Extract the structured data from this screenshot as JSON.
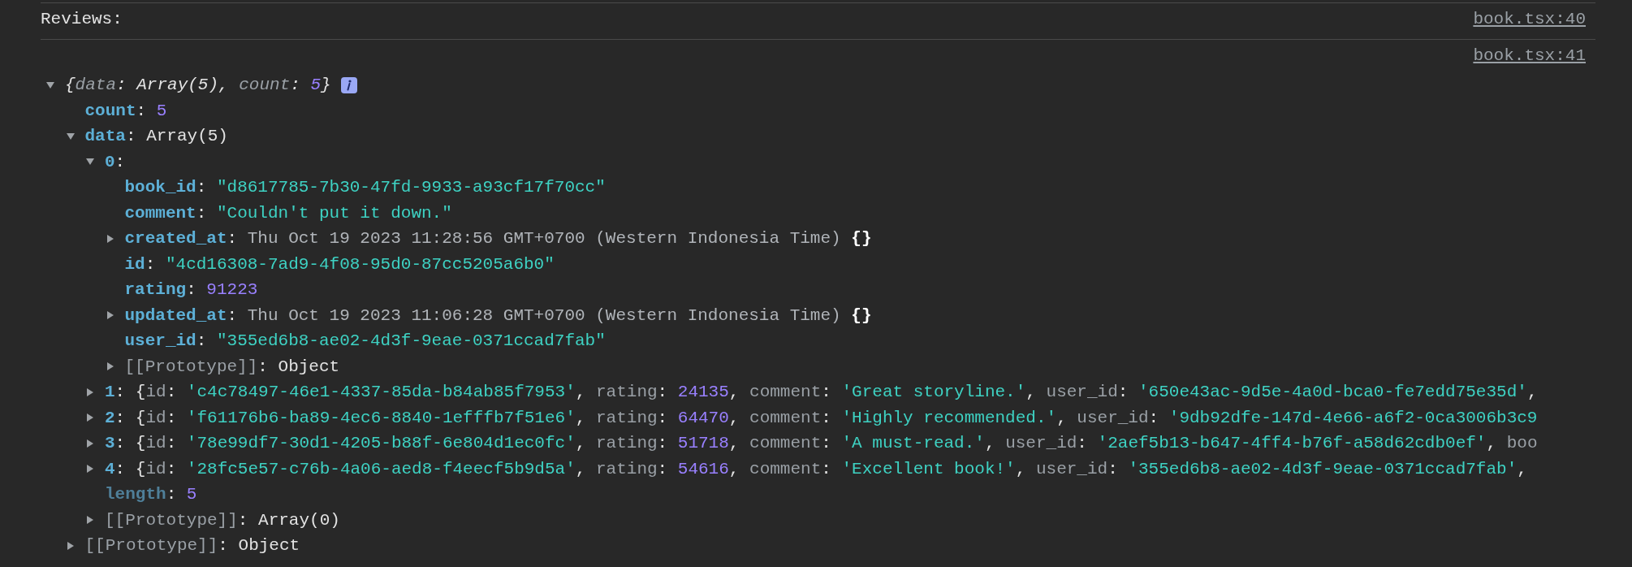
{
  "messages": [
    {
      "text": "Reviews:",
      "source": "book.tsx:40"
    },
    {
      "source": "book.tsx:41",
      "tree": {
        "expanded": true,
        "parts": [
          {
            "kind": "punct",
            "text": "{"
          },
          {
            "kind": "prevkey",
            "text": "data"
          },
          {
            "kind": "punct",
            "text": ": Array(5), "
          },
          {
            "kind": "prevkey",
            "text": "count"
          },
          {
            "kind": "punct",
            "text": ": "
          },
          {
            "kind": "number",
            "text": "5"
          },
          {
            "kind": "punct",
            "text": "}"
          }
        ],
        "info_badge": true,
        "children": [
          {
            "parts": [
              {
                "kind": "key",
                "text": "count"
              },
              {
                "kind": "punct",
                "text": ": "
              },
              {
                "kind": "number",
                "text": "5"
              }
            ]
          },
          {
            "expanded": true,
            "parts": [
              {
                "kind": "key",
                "text": "data"
              },
              {
                "kind": "punct",
                "text": ": Array(5)"
              }
            ],
            "children": [
              {
                "expanded": true,
                "parts": [
                  {
                    "kind": "key",
                    "text": "0"
                  },
                  {
                    "kind": "punct",
                    "text": ":"
                  }
                ],
                "children": [
                  {
                    "parts": [
                      {
                        "kind": "key",
                        "text": "book_id"
                      },
                      {
                        "kind": "punct",
                        "text": ": "
                      },
                      {
                        "kind": "string",
                        "text": "\"d8617785-7b30-47fd-9933-a93cf17f70cc\""
                      }
                    ]
                  },
                  {
                    "parts": [
                      {
                        "kind": "key",
                        "text": "comment"
                      },
                      {
                        "kind": "punct",
                        "text": ": "
                      },
                      {
                        "kind": "string",
                        "text": "\"Couldn't put it down.\""
                      }
                    ]
                  },
                  {
                    "expanded": false,
                    "parts": [
                      {
                        "kind": "key",
                        "text": "created_at"
                      },
                      {
                        "kind": "punct",
                        "text": ": "
                      },
                      {
                        "kind": "date",
                        "text": "Thu Oct 19 2023 11:28:56 GMT+0700 (Western Indonesia Time) "
                      },
                      {
                        "kind": "brace",
                        "text": "{}"
                      }
                    ]
                  },
                  {
                    "parts": [
                      {
                        "kind": "key",
                        "text": "id"
                      },
                      {
                        "kind": "punct",
                        "text": ": "
                      },
                      {
                        "kind": "string",
                        "text": "\"4cd16308-7ad9-4f08-95d0-87cc5205a6b0\""
                      }
                    ]
                  },
                  {
                    "parts": [
                      {
                        "kind": "key",
                        "text": "rating"
                      },
                      {
                        "kind": "punct",
                        "text": ": "
                      },
                      {
                        "kind": "number",
                        "text": "91223"
                      }
                    ]
                  },
                  {
                    "expanded": false,
                    "parts": [
                      {
                        "kind": "key",
                        "text": "updated_at"
                      },
                      {
                        "kind": "punct",
                        "text": ": "
                      },
                      {
                        "kind": "date",
                        "text": "Thu Oct 19 2023 11:06:28 GMT+0700 (Western Indonesia Time) "
                      },
                      {
                        "kind": "brace",
                        "text": "{}"
                      }
                    ]
                  },
                  {
                    "parts": [
                      {
                        "kind": "key",
                        "text": "user_id"
                      },
                      {
                        "kind": "punct",
                        "text": ": "
                      },
                      {
                        "kind": "string",
                        "text": "\"355ed6b8-ae02-4d3f-9eae-0371ccad7fab\""
                      }
                    ]
                  },
                  {
                    "expanded": false,
                    "parts": [
                      {
                        "kind": "proto",
                        "text": "[[Prototype]]"
                      },
                      {
                        "kind": "punct",
                        "text": ": Object"
                      }
                    ]
                  }
                ]
              },
              {
                "expanded": false,
                "parts": [
                  {
                    "kind": "key",
                    "text": "1"
                  },
                  {
                    "kind": "punct",
                    "text": ": {"
                  },
                  {
                    "kind": "prevkey",
                    "text": "id"
                  },
                  {
                    "kind": "punct",
                    "text": ": "
                  },
                  {
                    "kind": "string",
                    "text": "'c4c78497-46e1-4337-85da-b84ab85f7953'"
                  },
                  {
                    "kind": "punct",
                    "text": ", "
                  },
                  {
                    "kind": "prevkey",
                    "text": "rating"
                  },
                  {
                    "kind": "punct",
                    "text": ": "
                  },
                  {
                    "kind": "number",
                    "text": "24135"
                  },
                  {
                    "kind": "punct",
                    "text": ", "
                  },
                  {
                    "kind": "prevkey",
                    "text": "comment"
                  },
                  {
                    "kind": "punct",
                    "text": ": "
                  },
                  {
                    "kind": "string",
                    "text": "'Great storyline.'"
                  },
                  {
                    "kind": "punct",
                    "text": ", "
                  },
                  {
                    "kind": "prevkey",
                    "text": "user_id"
                  },
                  {
                    "kind": "punct",
                    "text": ": "
                  },
                  {
                    "kind": "string",
                    "text": "'650e43ac-9d5e-4a0d-bca0-fe7edd75e35d'"
                  },
                  {
                    "kind": "punct",
                    "text": ","
                  }
                ]
              },
              {
                "expanded": false,
                "parts": [
                  {
                    "kind": "key",
                    "text": "2"
                  },
                  {
                    "kind": "punct",
                    "text": ": {"
                  },
                  {
                    "kind": "prevkey",
                    "text": "id"
                  },
                  {
                    "kind": "punct",
                    "text": ": "
                  },
                  {
                    "kind": "string",
                    "text": "'f61176b6-ba89-4ec6-8840-1efffb7f51e6'"
                  },
                  {
                    "kind": "punct",
                    "text": ", "
                  },
                  {
                    "kind": "prevkey",
                    "text": "rating"
                  },
                  {
                    "kind": "punct",
                    "text": ": "
                  },
                  {
                    "kind": "number",
                    "text": "64470"
                  },
                  {
                    "kind": "punct",
                    "text": ", "
                  },
                  {
                    "kind": "prevkey",
                    "text": "comment"
                  },
                  {
                    "kind": "punct",
                    "text": ": "
                  },
                  {
                    "kind": "string",
                    "text": "'Highly recommended.'"
                  },
                  {
                    "kind": "punct",
                    "text": ", "
                  },
                  {
                    "kind": "prevkey",
                    "text": "user_id"
                  },
                  {
                    "kind": "punct",
                    "text": ": "
                  },
                  {
                    "kind": "string",
                    "text": "'9db92dfe-147d-4e66-a6f2-0ca3006b3c9"
                  }
                ]
              },
              {
                "expanded": false,
                "parts": [
                  {
                    "kind": "key",
                    "text": "3"
                  },
                  {
                    "kind": "punct",
                    "text": ": {"
                  },
                  {
                    "kind": "prevkey",
                    "text": "id"
                  },
                  {
                    "kind": "punct",
                    "text": ": "
                  },
                  {
                    "kind": "string",
                    "text": "'78e99df7-30d1-4205-b88f-6e804d1ec0fc'"
                  },
                  {
                    "kind": "punct",
                    "text": ", "
                  },
                  {
                    "kind": "prevkey",
                    "text": "rating"
                  },
                  {
                    "kind": "punct",
                    "text": ": "
                  },
                  {
                    "kind": "number",
                    "text": "51718"
                  },
                  {
                    "kind": "punct",
                    "text": ", "
                  },
                  {
                    "kind": "prevkey",
                    "text": "comment"
                  },
                  {
                    "kind": "punct",
                    "text": ": "
                  },
                  {
                    "kind": "string",
                    "text": "'A must-read.'"
                  },
                  {
                    "kind": "punct",
                    "text": ", "
                  },
                  {
                    "kind": "prevkey",
                    "text": "user_id"
                  },
                  {
                    "kind": "punct",
                    "text": ": "
                  },
                  {
                    "kind": "string",
                    "text": "'2aef5b13-b647-4ff4-b76f-a58d62cdb0ef'"
                  },
                  {
                    "kind": "punct",
                    "text": ", "
                  },
                  {
                    "kind": "prevkey",
                    "text": "boo"
                  }
                ]
              },
              {
                "expanded": false,
                "parts": [
                  {
                    "kind": "key",
                    "text": "4"
                  },
                  {
                    "kind": "punct",
                    "text": ": {"
                  },
                  {
                    "kind": "prevkey",
                    "text": "id"
                  },
                  {
                    "kind": "punct",
                    "text": ": "
                  },
                  {
                    "kind": "string",
                    "text": "'28fc5e57-c76b-4a06-aed8-f4eecf5b9d5a'"
                  },
                  {
                    "kind": "punct",
                    "text": ", "
                  },
                  {
                    "kind": "prevkey",
                    "text": "rating"
                  },
                  {
                    "kind": "punct",
                    "text": ": "
                  },
                  {
                    "kind": "number",
                    "text": "54616"
                  },
                  {
                    "kind": "punct",
                    "text": ", "
                  },
                  {
                    "kind": "prevkey",
                    "text": "comment"
                  },
                  {
                    "kind": "punct",
                    "text": ": "
                  },
                  {
                    "kind": "string",
                    "text": "'Excellent book!'"
                  },
                  {
                    "kind": "punct",
                    "text": ", "
                  },
                  {
                    "kind": "prevkey",
                    "text": "user_id"
                  },
                  {
                    "kind": "punct",
                    "text": ": "
                  },
                  {
                    "kind": "string",
                    "text": "'355ed6b8-ae02-4d3f-9eae-0371ccad7fab'"
                  },
                  {
                    "kind": "punct",
                    "text": ","
                  }
                ]
              },
              {
                "parts": [
                  {
                    "kind": "dimkey",
                    "text": "length"
                  },
                  {
                    "kind": "punct",
                    "text": ": "
                  },
                  {
                    "kind": "number",
                    "text": "5"
                  }
                ]
              },
              {
                "expanded": false,
                "parts": [
                  {
                    "kind": "proto",
                    "text": "[[Prototype]]"
                  },
                  {
                    "kind": "punct",
                    "text": ": Array(0)"
                  }
                ]
              }
            ]
          },
          {
            "expanded": false,
            "parts": [
              {
                "kind": "proto",
                "text": "[[Prototype]]"
              },
              {
                "kind": "punct",
                "text": ": Object"
              }
            ]
          }
        ]
      }
    }
  ]
}
